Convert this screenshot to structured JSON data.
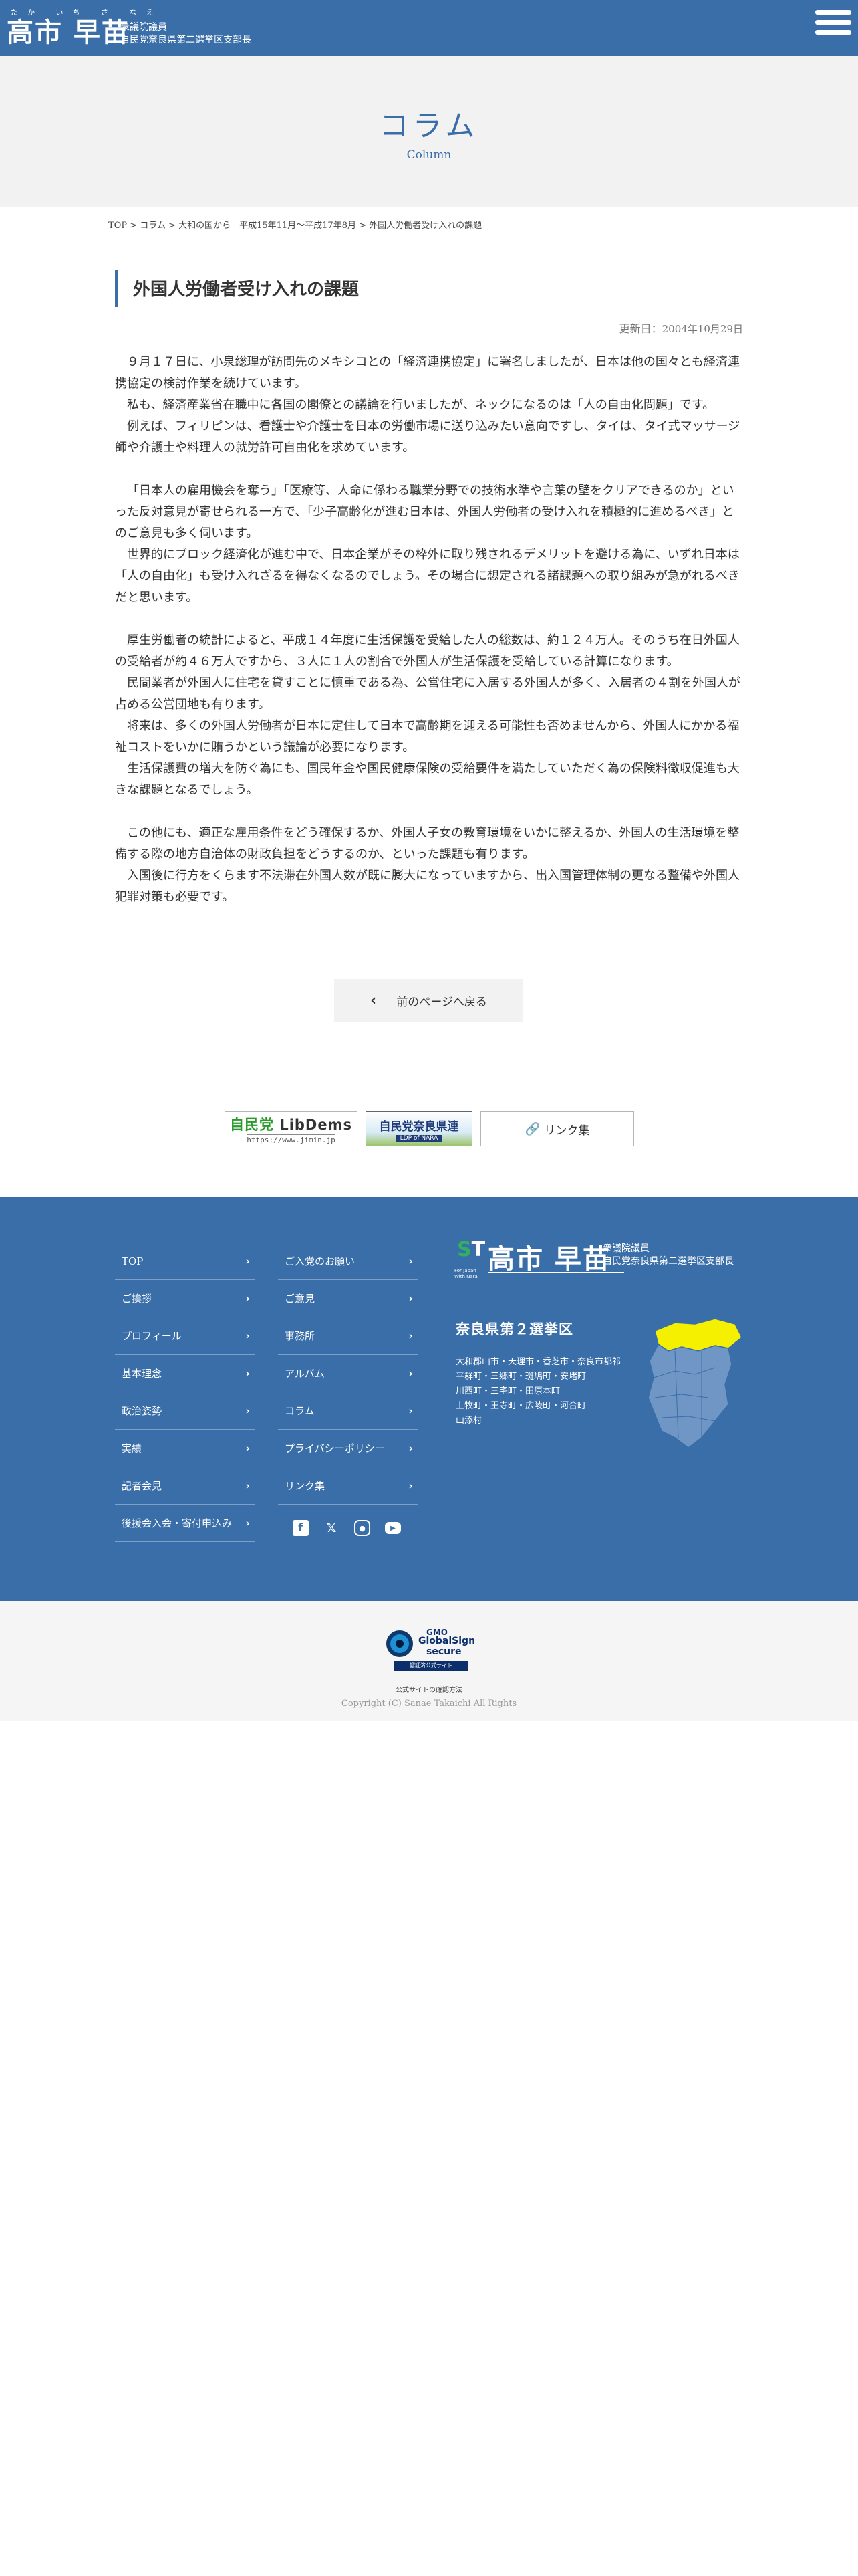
{
  "header": {
    "logo_ruby": "たか いち さ なえ",
    "logo_name": "高市 早苗",
    "logo_sub_1": "衆議院議員",
    "logo_sub_2": "自民党奈良県第二選挙区支部長",
    "menu_icon": "hamburger-icon"
  },
  "hero": {
    "title": "コラム",
    "subtitle": "Column"
  },
  "breadcrumb": {
    "items": [
      "TOP",
      "コラム",
      "大和の国から　平成15年11月～平成17年8月"
    ],
    "separator": ">",
    "current": "外国人労働者受け入れの課題"
  },
  "article": {
    "title": "外国人労働者受け入れの課題",
    "updated_label": "更新日：",
    "updated_date": "2004年10月29日",
    "paragraphs": [
      "９月１７日に、小泉総理が訪問先のメキシコとの「経済連携協定」に署名しましたが、日本は他の国々とも経済連携協定の検討作業を続けています。",
      "私も、経済産業省在職中に各国の閣僚との議論を行いましたが、ネックになるのは「人の自由化問題」です。",
      "例えば、フィリピンは、看護士や介護士を日本の労働市場に送り込みたい意向ですし、タイは、タイ式マッサージ師や介護士や料理人の就労許可自由化を求めています。",
      "「日本人の雇用機会を奪う」「医療等、人命に係わる職業分野での技術水準や言葉の壁をクリアできるのか」といった反対意見が寄せられる一方で、「少子高齢化が進む日本は、外国人労働者の受け入れを積極的に進めるべき」とのご意見も多く伺います。",
      "世界的にブロック経済化が進む中で、日本企業がその枠外に取り残されるデメリットを避ける為に、いずれ日本は「人の自由化」も受け入れざるを得なくなるのでしょう。その場合に想定される諸課題への取り組みが急がれるべきだと思います。",
      "厚生労働者の統計によると、平成１４年度に生活保護を受給した人の総数は、約１２４万人。そのうち在日外国人の受給者が約４６万人ですから、３人に１人の割合で外国人が生活保護を受給している計算になります。",
      "民間業者が外国人に住宅を貸すことに慎重である為、公営住宅に入居する外国人が多く、入居者の４割を外国人が占める公営団地も有ります。",
      "将来は、多くの外国人労働者が日本に定住して日本で高齢期を迎える可能性も否めませんから、外国人にかかる福祉コストをいかに賄うかという議論が必要になります。",
      "生活保護費の増大を防ぐ為にも、国民年金や国民健康保険の受給要件を満たしていただく為の保険料徴収促進も大きな課題となるでしょう。",
      "この他にも、適正な雇用条件をどう確保するか、外国人子女の教育環境をいかに整えるか、外国人の生活環境を整備する際の地方自治体の財政負担をどうするのか、といった課題も有ります。",
      "入国後に行方をくらます不法滞在外国人数が既に膨大になっていますから、出入国管理体制の更なる整備や外国人犯罪対策も必要です。"
    ]
  },
  "back_button": {
    "label": "前のページへ戻る",
    "icon": "chevron-left-icon"
  },
  "banners": {
    "jimin_title_a": "自民党",
    "jimin_title_b": "LibDems",
    "jimin_url": "https://www.jimin.jp",
    "nara_title": "自民党奈良県連",
    "nara_sub": "LDP of NARA",
    "links_label": "リンク集",
    "links_icon": "link-icon"
  },
  "footer": {
    "nav_col1": [
      "TOP",
      "ご挨拶",
      "プロフィール",
      "基本理念",
      "政治姿勢",
      "実績",
      "記者会見",
      "後援会入会・寄付申込み"
    ],
    "nav_col2": [
      "ご入党のお願い",
      "ご意見",
      "事務所",
      "アルバム",
      "コラム",
      "プライバシーポリシー",
      "リンク集"
    ],
    "logo_name": "高市 早苗",
    "logo_sub_1": "衆議院議員",
    "logo_sub_2": "自民党奈良県第二選挙区支部長",
    "logo_tag": "For Japan With Nara",
    "district_title": "奈良県第２選挙区",
    "cities": [
      "大和郡山市・天理市・香芝市・奈良市都祁",
      "平群町・三郷町・斑鳩町・安堵町",
      "川西町・三宅町・田原本町",
      "上牧町・王寺町・広陵町・河合町",
      "山添村"
    ],
    "social_icons": [
      "facebook-icon",
      "x-icon",
      "instagram-icon",
      "youtube-icon"
    ],
    "accent_color": "#3a6ea8",
    "highlight_color": "#f5f000"
  },
  "bottom": {
    "globalsign_1": "GMO",
    "globalsign_2": "GlobalSign",
    "globalsign_3": "secure",
    "globalsign_4": "認証済公式サイト",
    "verify_text": "公式サイトの確認方法",
    "copyright": "Copyright (C) Sanae Takaichi All Rights"
  }
}
